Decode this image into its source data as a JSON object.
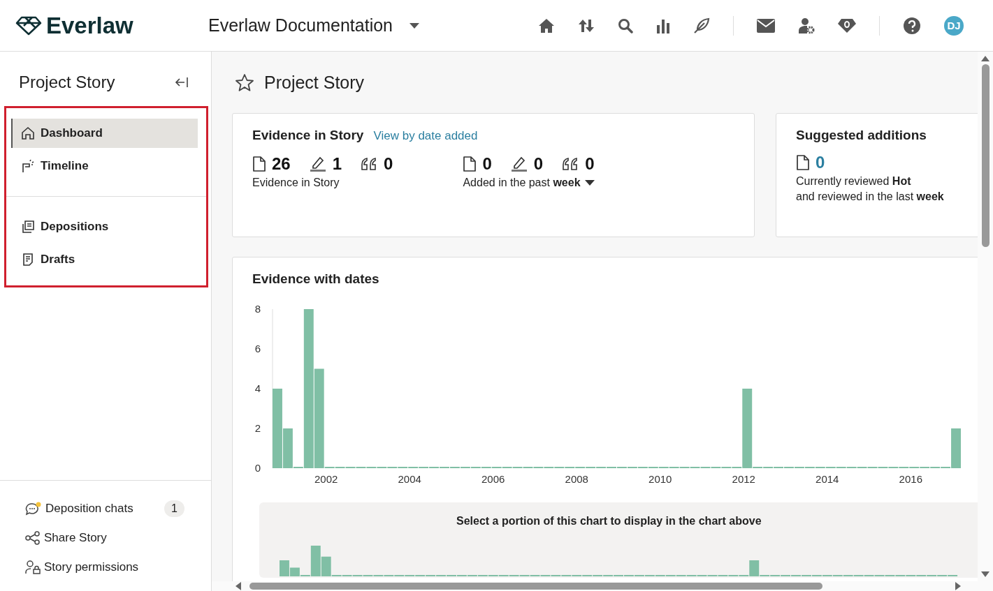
{
  "header": {
    "logo": "Everlaw",
    "project": "Everlaw Documentation",
    "avatar": "DJ"
  },
  "sidebar": {
    "title": "Project Story",
    "groups": [
      [
        {
          "label": "Dashboard",
          "selected": true
        },
        {
          "label": "Timeline",
          "selected": false
        }
      ],
      [
        {
          "label": "Depositions",
          "selected": false
        },
        {
          "label": "Drafts",
          "selected": false
        }
      ]
    ],
    "footer": [
      {
        "label": "Deposition chats",
        "badge": "1"
      },
      {
        "label": "Share Story"
      },
      {
        "label": "Story permissions"
      }
    ]
  },
  "main": {
    "title": "Project Story",
    "evidence_card": {
      "title": "Evidence in Story",
      "link": "View by date added",
      "groups": [
        {
          "counts": [
            "26",
            "1",
            "0"
          ],
          "caption": "Evidence in Story",
          "dropdown": false
        },
        {
          "counts": [
            "0",
            "0",
            "0"
          ],
          "caption": "Added in the past **week**",
          "dropdown": true
        }
      ]
    },
    "suggested_card": {
      "title": "Suggested additions",
      "count": "0",
      "lines": [
        "Currently reviewed **Hot**",
        "and reviewed in the last **week**"
      ]
    },
    "chart_card": {
      "title": "Evidence with dates",
      "chart_data": {
        "type": "bar",
        "x": [
          2000.75,
          2001,
          2001.25,
          2001.5,
          2001.75,
          2002,
          2002.25,
          2002.5,
          2002.75,
          2003,
          2003.25,
          2003.5,
          2003.75,
          2004,
          2004.25,
          2004.5,
          2004.75,
          2005,
          2005.25,
          2005.5,
          2005.75,
          2006,
          2006.25,
          2006.5,
          2006.75,
          2007,
          2007.25,
          2007.5,
          2007.75,
          2008,
          2008.25,
          2008.5,
          2008.75,
          2009,
          2009.25,
          2009.5,
          2009.75,
          2010,
          2010.25,
          2010.5,
          2010.75,
          2011,
          2011.25,
          2011.5,
          2011.75,
          2012,
          2012.25,
          2012.5,
          2012.75,
          2013,
          2013.25,
          2013.5,
          2013.75,
          2014,
          2014.25,
          2014.5,
          2014.75,
          2015,
          2015.25,
          2015.5,
          2015.75,
          2016,
          2016.25,
          2016.5,
          2016.75,
          2017
        ],
        "values": [
          4,
          2,
          0,
          8,
          5,
          0,
          0,
          0,
          0,
          0,
          0,
          0,
          0,
          0,
          0,
          0,
          0,
          0,
          0,
          0,
          0,
          0,
          0,
          0,
          0,
          0,
          0,
          0,
          0,
          0,
          0,
          0,
          0,
          0,
          0,
          0,
          0,
          0,
          0,
          0,
          0,
          0,
          0,
          0,
          0,
          4,
          0,
          0,
          0,
          0,
          0,
          0,
          0,
          0,
          0,
          0,
          0,
          0,
          0,
          0,
          0,
          0,
          0,
          0,
          0,
          2
        ],
        "xlim": [
          2000.75,
          2017.25
        ],
        "ylim": [
          0,
          8
        ],
        "xticks": [
          2002,
          2004,
          2006,
          2008,
          2010,
          2012,
          2014,
          2016
        ],
        "yticks": [
          0,
          2,
          4,
          6,
          8
        ]
      },
      "overview_caption": "Select a portion of this chart to display in the chart above"
    }
  }
}
